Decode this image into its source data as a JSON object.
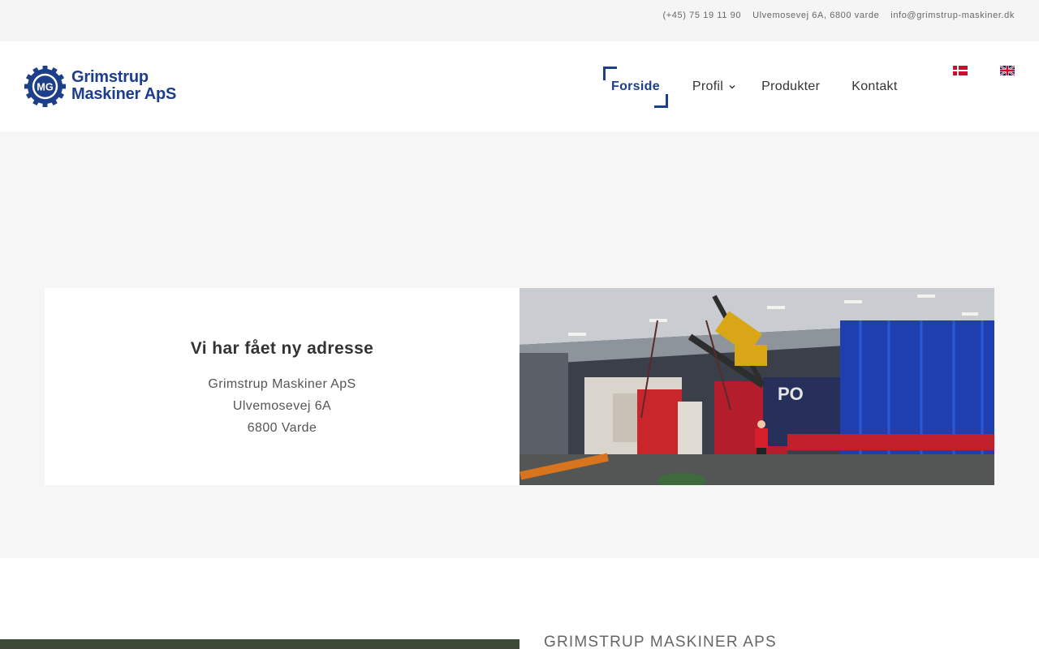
{
  "topbar": {
    "phone": "(+45) 75 19 11 90",
    "address": "Ulvemosevej 6A, 6800 varde",
    "email": "info@grimstrup-maskiner.dk"
  },
  "logo": {
    "line1": "Grimstrup",
    "line2": "Maskiner ApS",
    "mark_letters": "MG",
    "color": "#1d3f8a"
  },
  "nav": {
    "items": [
      {
        "label": "Forside",
        "active": true
      },
      {
        "label": "Profil",
        "has_dropdown": true,
        "icon": "chevron-down-icon"
      },
      {
        "label": "Produkter"
      },
      {
        "label": "Kontakt"
      }
    ],
    "accent": "#1d3f8a"
  },
  "languages": [
    {
      "icon": "danish-flag-icon"
    },
    {
      "icon": "english-flag-icon"
    }
  ],
  "hero": {
    "heading": "Vi har fået ny adresse",
    "lines": [
      "Grimstrup Maskiner ApS",
      "Ulvemosevej 6A",
      "6800 Varde"
    ],
    "photo_icon": "workshop-crane-photo"
  },
  "section": {
    "title": "GRIMSTRUP MASKINER APS"
  }
}
